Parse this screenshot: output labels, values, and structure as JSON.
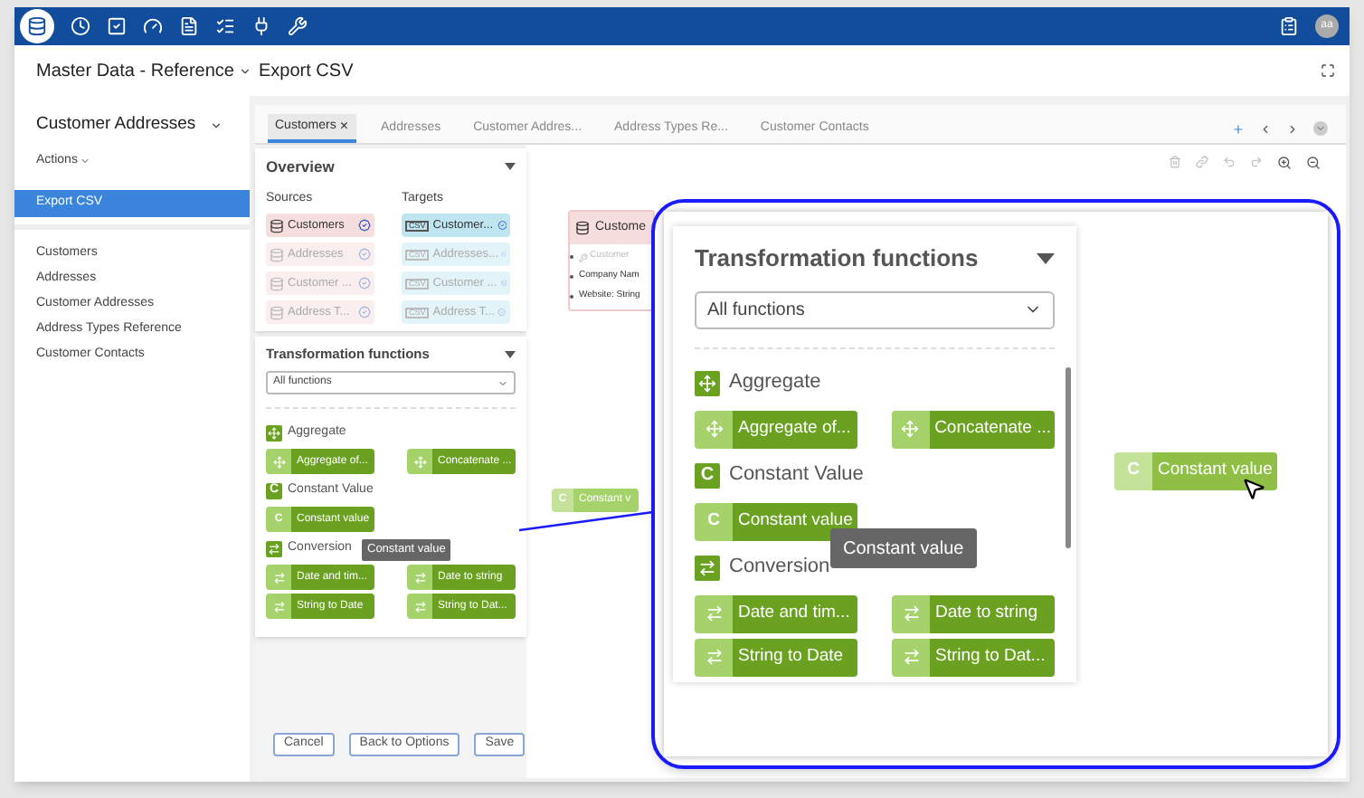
{
  "top_bar": {
    "avatar": "aa"
  },
  "header": {
    "project": "Master Data - Reference",
    "page": "Export CSV"
  },
  "sidebar": {
    "title": "Customer Addresses",
    "actions": "Actions",
    "nav": [
      {
        "label": "Export CSV",
        "selected": true
      }
    ],
    "entities": [
      "Customers",
      "Addresses",
      "Customer Addresses",
      "Address Types Reference",
      "Customer Contacts"
    ]
  },
  "tabs": [
    {
      "label": "Customers",
      "selected": true,
      "close_symbol": "×"
    },
    {
      "label": "Addresses",
      "selected": false
    },
    {
      "label": "Customer Addres...",
      "selected": false
    },
    {
      "label": "Address Types Re...",
      "selected": false
    },
    {
      "label": "Customer Contacts",
      "selected": false
    }
  ],
  "overview": {
    "title": "Overview",
    "sources_label": "Sources",
    "targets_label": "Targets",
    "sources": [
      {
        "label": "Customers",
        "enabled": true
      },
      {
        "label": "Addresses",
        "enabled": false
      },
      {
        "label": "Customer ...",
        "enabled": false
      },
      {
        "label": "Address T...",
        "enabled": false
      }
    ],
    "targets": [
      {
        "badge": "CSV",
        "label": "Customer...",
        "enabled": true
      },
      {
        "badge": "CSV",
        "label": "Addresses...",
        "enabled": false
      },
      {
        "badge": "CSV",
        "label": "Customer ...",
        "enabled": false
      },
      {
        "badge": "CSV",
        "label": "Address T...",
        "enabled": false
      }
    ]
  },
  "functions": {
    "title": "Transformation functions",
    "filter": "All functions",
    "tooltip": "Constant value",
    "groups": [
      {
        "kind": "aggregate",
        "name": "Aggregate",
        "items": [
          {
            "label": "Aggregate of..."
          },
          {
            "label": "Concatenate ..."
          }
        ]
      },
      {
        "kind": "constant",
        "name": "Constant Value",
        "letter": "C",
        "items": [
          {
            "label": "Constant value",
            "letter": "C"
          }
        ]
      },
      {
        "kind": "conversion",
        "name": "Conversion",
        "items": [
          {
            "label": "Date and tim..."
          },
          {
            "label": "Date to string"
          },
          {
            "label": "String to Date"
          },
          {
            "label": "String to Dat..."
          }
        ]
      }
    ]
  },
  "buttons": [
    "Cancel",
    "Back to Options",
    "Save"
  ],
  "canvas": {
    "node": {
      "title": "Custome",
      "fields": [
        {
          "label": "Customer",
          "key": true
        },
        {
          "label": "Company Nam",
          "key": false
        },
        {
          "label": "Website: String",
          "key": false
        }
      ]
    },
    "dropped_chip": {
      "letter": "C",
      "label": "Constant v"
    }
  },
  "callout": {
    "title": "Transformation functions",
    "filter": "All functions",
    "tooltip": "Constant value",
    "groups": [
      {
        "kind": "aggregate",
        "name": "Aggregate",
        "items": [
          {
            "label": "Aggregate of..."
          },
          {
            "label": "Concatenate ..."
          }
        ]
      },
      {
        "kind": "constant",
        "name": "Constant Value",
        "letter": "C",
        "items": [
          {
            "label": "Constant value",
            "letter": "C"
          }
        ]
      },
      {
        "kind": "conversion",
        "name": "Conversion",
        "items": [
          {
            "label": "Date and tim..."
          },
          {
            "label": "Date to string"
          },
          {
            "label": "String to Date"
          },
          {
            "label": "String to Dat..."
          }
        ]
      }
    ],
    "dragged_chip": {
      "letter": "C",
      "label": "Constant value"
    }
  }
}
